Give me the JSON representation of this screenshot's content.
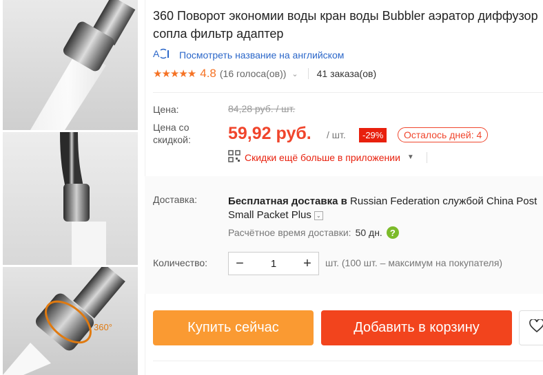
{
  "product": {
    "title": "360 Поворот экономии воды кран воды Bubbler аэратор диффузор сопла фильтр адаптер",
    "translate_link": "Посмотреть название на английском",
    "rating": "4.8",
    "votes": "(16 голоса(ов))",
    "orders": "41 заказа(ов)"
  },
  "price": {
    "label": "Цена:",
    "old": "84,28 руб. / шт.",
    "discount_label": "Цена со скидкой:",
    "current": "59,92 руб.",
    "unit": "/ шт.",
    "discount_badge": "-29%",
    "days_left": "Осталось дней: 4",
    "app_promo": "Скидки ещё больше в приложении"
  },
  "shipping": {
    "label": "Доставка:",
    "prefix": "Бесплатная доставка в",
    "destination": "Russian Federation службой China Post",
    "service": "Small Packet Plus",
    "time_label": "Расчётное время доставки:",
    "time_value": "50 дн."
  },
  "quantity": {
    "label": "Количество:",
    "value": "1",
    "note": "шт. (100 шт. – максимум на покупателя)"
  },
  "buttons": {
    "buy_now": "Купить сейчас",
    "add_to_cart": "Добавить в корзину"
  },
  "thumbs": {
    "badge_360": "360°"
  },
  "colors": {
    "accent": "#f0452c",
    "buy": "#fa9a32",
    "cart": "#f2441d",
    "link": "#2b67c9",
    "star": "#f57224"
  }
}
